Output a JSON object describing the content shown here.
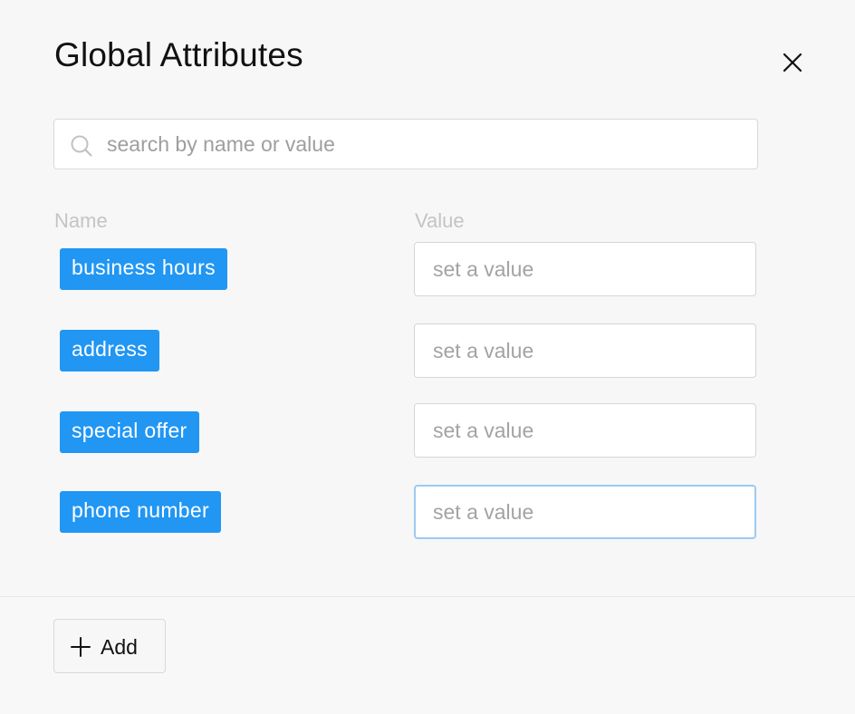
{
  "dialog": {
    "title": "Global Attributes",
    "close_icon": "close-icon"
  },
  "search": {
    "icon": "search-icon",
    "placeholder": "search by name or value",
    "value": ""
  },
  "columns": {
    "name": "Name",
    "value": "Value"
  },
  "attributes": [
    {
      "name": "business hours",
      "value": "",
      "placeholder": "set a value"
    },
    {
      "name": "address",
      "value": "",
      "placeholder": "set a value"
    },
    {
      "name": "special offer",
      "value": "",
      "placeholder": "set a value"
    },
    {
      "name": "phone number",
      "value": "",
      "placeholder": "set a value",
      "focused": true
    }
  ],
  "footer": {
    "add_label": "Add",
    "add_icon": "plus-icon"
  },
  "colors": {
    "tag_background": "#2196f3",
    "focus_border": "#9ccaf2",
    "background": "#f7f7f7"
  }
}
